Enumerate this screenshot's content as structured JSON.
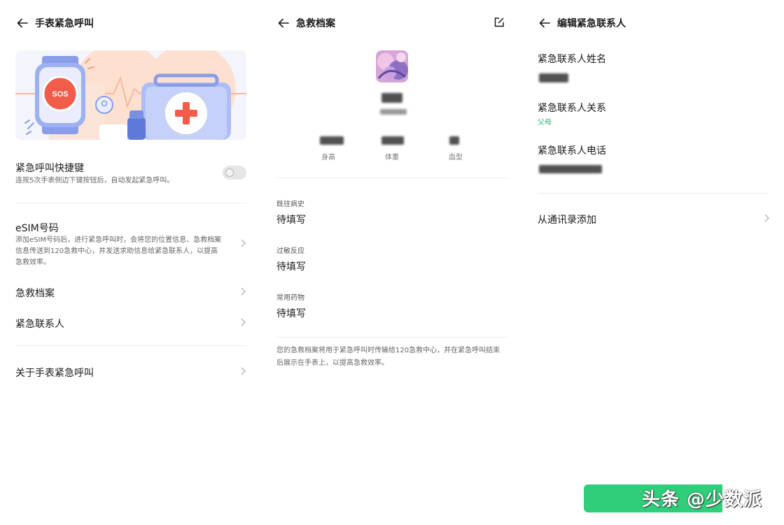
{
  "colors": {
    "accent_green": "#23b46b",
    "watermark_green": "#2fce7a",
    "sos_red": "#f25c4a"
  },
  "panel1": {
    "title": "手表紧急呼叫",
    "banner": {
      "sos": "SOS"
    },
    "shortcut": {
      "title": "紧急呼叫快捷键",
      "desc": "连按5次手表侧边下键按钮后，自动发起紧急呼叫。",
      "enabled": false
    },
    "esim": {
      "title": "eSIM号码",
      "desc": [
        "添加eSIM号码后，进行紧急呼叫时，会将您的位置信息、急救档案",
        "信息传送到120急救中心，并发送求助信息给紧急联系人，以提高",
        "急救效率。"
      ]
    },
    "medical": {
      "title": "急救档案"
    },
    "contacts": {
      "title": "紧急联系人"
    },
    "about": {
      "title": "关于手表紧急呼叫"
    }
  },
  "panel2": {
    "title": "急救档案",
    "stats": [
      {
        "label": "身高"
      },
      {
        "label": "体重"
      },
      {
        "label": "血型"
      }
    ],
    "sections": [
      {
        "label": "既往病史",
        "value": "待填写"
      },
      {
        "label": "过敏反应",
        "value": "待填写"
      },
      {
        "label": "常用药物",
        "value": "待填写"
      }
    ],
    "note": [
      "您的急救档案将用于紧急呼叫时传输给120急救中心，并在紧急呼叫结束",
      "后展示在手表上，以提高急救效率。"
    ]
  },
  "panel3": {
    "title": "编辑紧急联系人",
    "name_label": "紧急联系人姓名",
    "relation_label": "紧急联系人关系",
    "relation_value": "父母",
    "phone_label": "紧急联系人电话",
    "add_from_contacts": "从通讯录添加"
  },
  "watermark": "头条 @少数派"
}
